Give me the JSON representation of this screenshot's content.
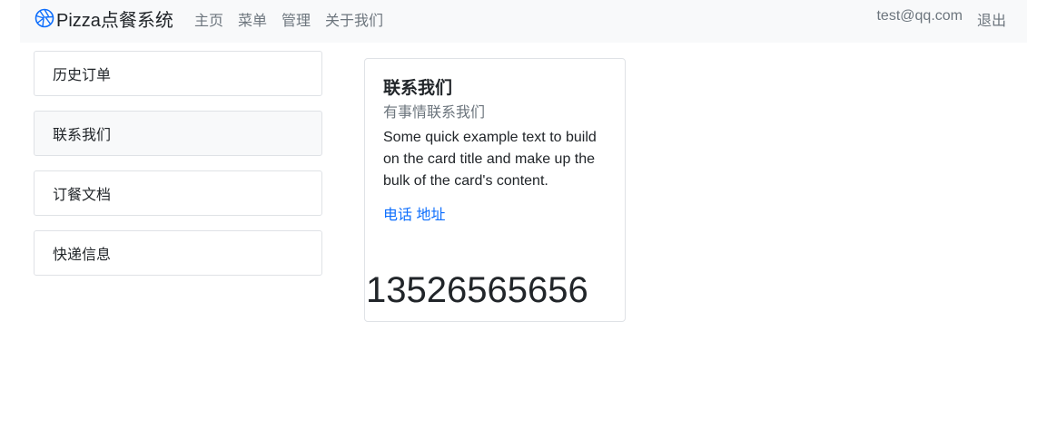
{
  "navbar": {
    "brand": "Pizza点餐系统",
    "brand_icon": "aperture-icon",
    "links": [
      "主页",
      "菜单",
      "管理",
      "关于我们"
    ],
    "user_email": "test@qq.com",
    "logout": "退出"
  },
  "sidebar": {
    "items": [
      {
        "label": "历史订单",
        "active": false
      },
      {
        "label": "联系我们",
        "active": true
      },
      {
        "label": "订餐文档",
        "active": false
      },
      {
        "label": "快递信息",
        "active": false
      }
    ]
  },
  "card": {
    "title": "联系我们",
    "subtitle": "有事情联系我们",
    "text": "Some quick example text to build on the card title and make up the bulk of the card's content.",
    "links": [
      "电话",
      "地址"
    ],
    "phone": "13526565656"
  },
  "colors": {
    "navbar_bg": "#f8f9fa",
    "link_blue": "#0d6efd",
    "muted": "#6c757d",
    "border": "#dfe2e6",
    "brand_icon": "#0d6efd"
  }
}
